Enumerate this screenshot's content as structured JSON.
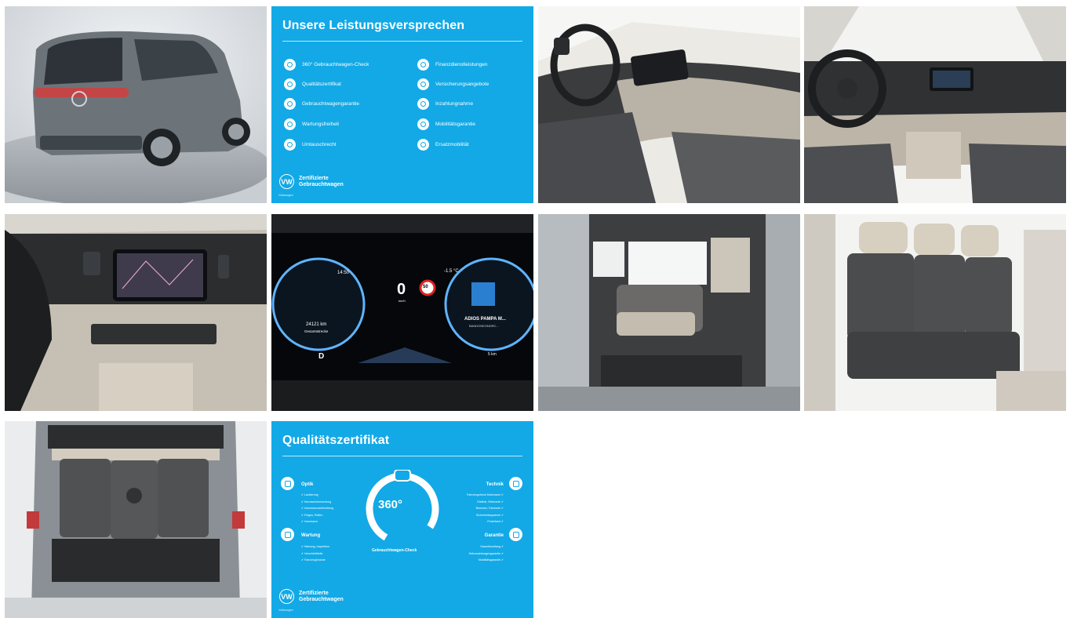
{
  "gallery": {
    "photos": [
      {
        "name": "rear-exterior-photo",
        "subject": "rear-exterior"
      },
      {
        "name": "cockpit-side-photo",
        "subject": "dashboard-side"
      },
      {
        "name": "cockpit-front-photo",
        "subject": "dashboard-front"
      },
      {
        "name": "infotainment-photo",
        "subject": "infotainment"
      },
      {
        "name": "instrument-cluster-photo",
        "subject": "instrument-cluster"
      },
      {
        "name": "sliding-door-interior-photo",
        "subject": "sliding-door"
      },
      {
        "name": "rear-seats-photo",
        "subject": "rear-seats"
      },
      {
        "name": "trunk-open-photo",
        "subject": "trunk"
      }
    ]
  },
  "promise_card": {
    "title": "Unsere Leistungsversprechen",
    "left_items": [
      "360° Gebrauchtwagen-Check",
      "Qualitätszertifikat",
      "Gebrauchtwagengarantie",
      "Wartungsfreiheit",
      "Umtauschrecht"
    ],
    "right_items": [
      "Finanzdienstleistungen",
      "Versicherungsangebote",
      "Inzahlungnahme",
      "Mobilitätsgarantie",
      "Ersatzmobilität"
    ],
    "brand_line1": "Zertifizierte",
    "brand_line2": "Gebrauchtwagen",
    "vw_logo": "VW",
    "brand_footer": "Volkswagen"
  },
  "quality_card": {
    "title": "Qualitätszertifikat",
    "optik": {
      "label": "Optik",
      "items": [
        "Lackierung",
        "Karosseriebewertung",
        "Innenraumaufbereitung",
        "Felgen, Reifen",
        "Innenraum"
      ]
    },
    "technik": {
      "label": "Technik",
      "items": [
        "Fahrzeugcheck Motorraum",
        "Elektrik, Elektronik",
        "Bremsen, Fahrwerk",
        "Sicherheitssysteme",
        "Probefahrt"
      ]
    },
    "wartung": {
      "label": "Wartung",
      "items": [
        "Wartung, Inspektion",
        "Verschleißteile",
        "Fahrzeughistorie"
      ]
    },
    "garantie": {
      "label": "Garantie",
      "items": [
        "Garantieumfang",
        "Gebrauchtwagengarantie",
        "Mobilitätsgarantie"
      ]
    },
    "check_number": "360°",
    "check_label": "Gebrauchtwagen-Check",
    "brand_line1": "Zertifizierte",
    "brand_line2": "Gebrauchtwagen",
    "vw_logo": "VW",
    "brand_footer": "Volkswagen"
  },
  "cluster": {
    "time": "14:50",
    "outside_temp": "-1.5 °C",
    "speed": "0",
    "speed_unit": "km/h",
    "speed_limit": "50",
    "odometer": "24121 km",
    "odometer_label": "Gesamtstrecke",
    "gear": "D",
    "media_title": "ADIOS PAMPA M...",
    "media_artist": "BANDONEONDRC...",
    "range": "5 km"
  },
  "colors": {
    "accent_blue": "#12a9e6",
    "white": "#ffffff"
  }
}
